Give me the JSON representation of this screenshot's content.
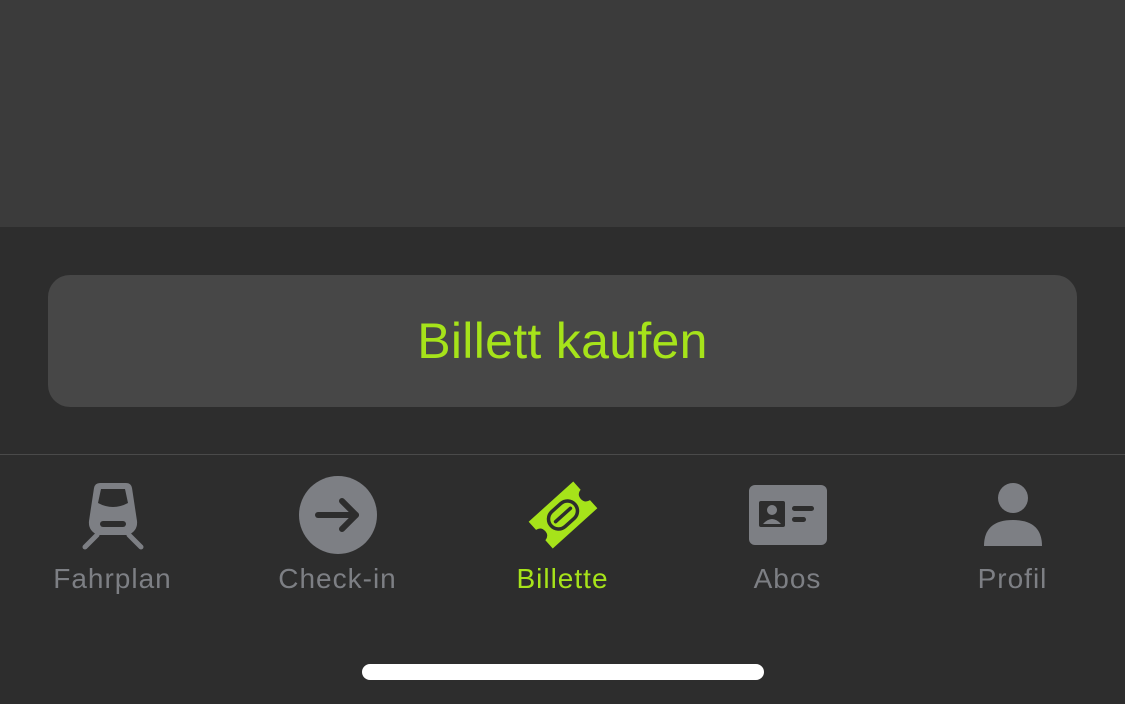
{
  "colors": {
    "accent": "#a6e31a",
    "inactive": "#7d7f84",
    "background": "#2d2d2d",
    "top_area": "#3b3b3b",
    "button_bg": "#474747"
  },
  "main": {
    "buy_button_label": "Billett kaufen"
  },
  "tab_bar": {
    "selected": "Billette",
    "tabs": [
      {
        "label": "Fahrplan",
        "icon": "train-icon"
      },
      {
        "label": "Check-in",
        "icon": "arrow-right-circle-icon"
      },
      {
        "label": "Billette",
        "icon": "ticket-icon"
      },
      {
        "label": "Abos",
        "icon": "id-card-icon"
      },
      {
        "label": "Profil",
        "icon": "person-icon"
      }
    ]
  }
}
